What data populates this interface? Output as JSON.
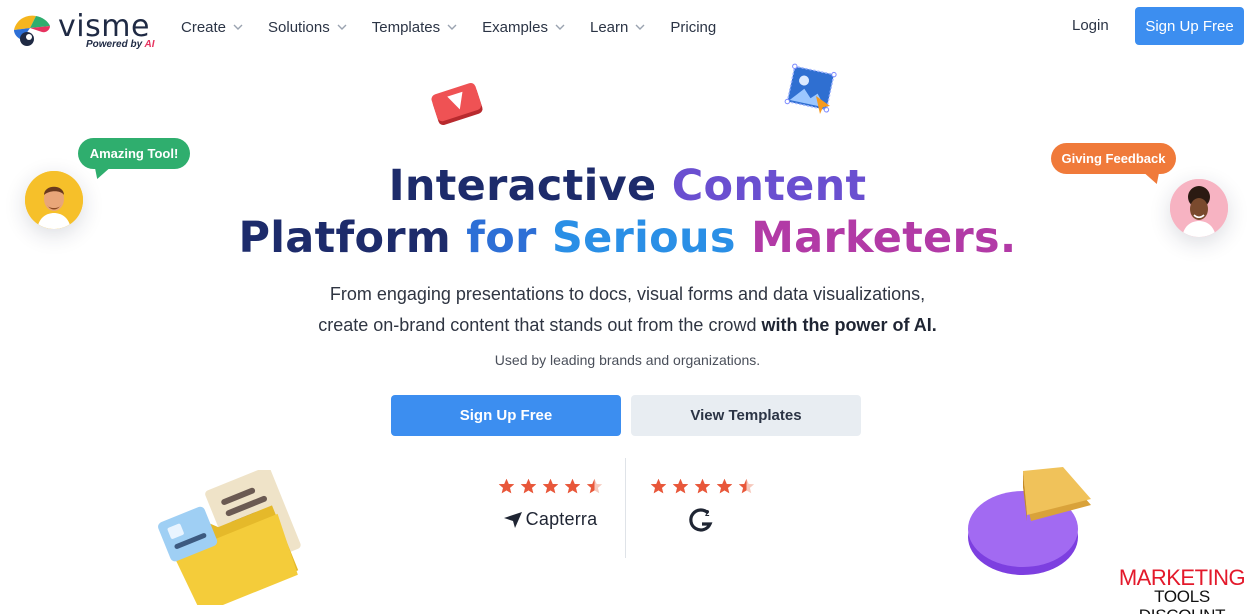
{
  "header": {
    "logo_text": "visme",
    "logo_sub_prefix": "Powered by ",
    "logo_sub_ai": "AI",
    "nav": [
      {
        "label": "Create",
        "has_dropdown": true
      },
      {
        "label": "Solutions",
        "has_dropdown": true
      },
      {
        "label": "Templates",
        "has_dropdown": true
      },
      {
        "label": "Examples",
        "has_dropdown": true
      },
      {
        "label": "Learn",
        "has_dropdown": true
      },
      {
        "label": "Pricing",
        "has_dropdown": false
      }
    ],
    "login_label": "Login",
    "signup_label": "Sign Up Free"
  },
  "hero": {
    "title_line1_a": "Interactive",
    "title_line1_b": "Content",
    "title_line2_a": "Platform",
    "title_line2_b": "for",
    "title_line2_c": "Serious",
    "title_line2_d": "Marketers.",
    "subtitle_line1": "From engaging presentations to docs, visual forms and data visualizations,",
    "subtitle_line2_plain": "create on-brand content that stands out from the crowd ",
    "subtitle_line2_bold": "with the power of AI.",
    "used_by": "Used by leading brands and organizations.",
    "primary_button": "Sign Up Free",
    "secondary_button": "View Templates"
  },
  "ratings": [
    {
      "source": "Capterra",
      "stars": 4.5,
      "logo_text": "Capterra"
    },
    {
      "source": "G2",
      "stars": 4.5,
      "logo_text": "G2"
    }
  ],
  "bubbles": {
    "left": "Amazing Tool!",
    "right": "Giving Feedback"
  },
  "watermark": {
    "line1": "MARKETING",
    "line2": "TOOLS DISCOUNT"
  },
  "colors": {
    "brand_blue": "#3c8ef0",
    "star_color": "#e8573a",
    "bubble_green": "#2fae6e",
    "bubble_orange": "#f07a3a",
    "title_navy": "#1d2b6b",
    "watermark_red": "#e3192b"
  },
  "icons": [
    "visme-logo-icon",
    "chevron-down-icon",
    "star-icon",
    "capterra-arrow-icon",
    "g2-logo-icon",
    "play-icon",
    "image-frame-icon",
    "folder-icon",
    "pie-chart-icon"
  ]
}
